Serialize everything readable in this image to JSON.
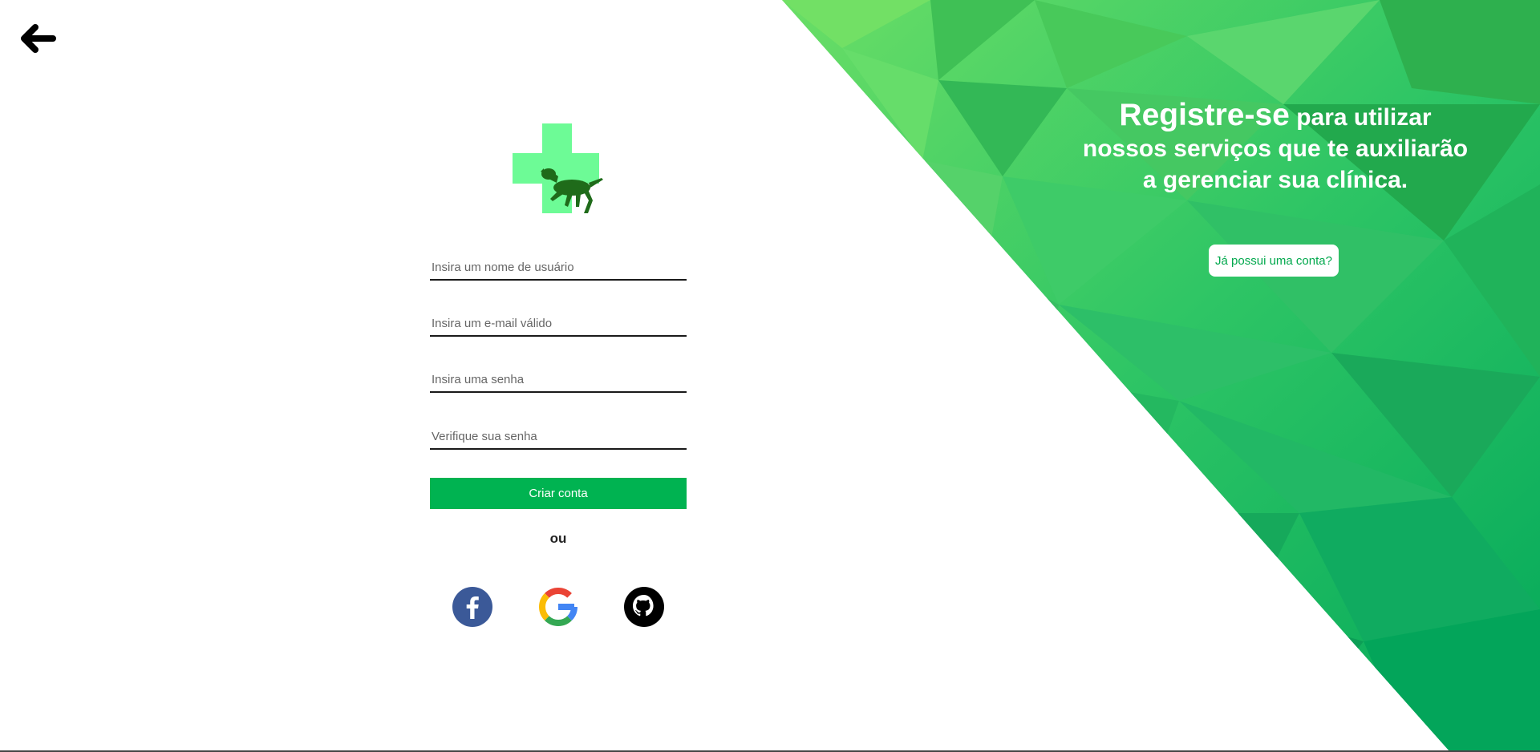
{
  "form": {
    "username_placeholder": "Insira um nome de usuário",
    "email_placeholder": "Insira um e-mail válido",
    "password_placeholder": "Insira uma senha",
    "confirm_placeholder": "Verifique sua senha",
    "submit_label": "Criar conta",
    "or_label": "ou"
  },
  "promo": {
    "highlight": "Registre-se",
    "rest": " para utilizar nossos serviços que te auxiliarão a gerenciar sua clínica.",
    "login_link": "Já possui uma conta?"
  },
  "colors": {
    "accent": "#00b351",
    "logo_cross": "#6dfb96",
    "logo_dog": "#1f6b1a",
    "facebook": "#3b5998",
    "github": "#000000"
  },
  "icons": [
    "arrow-left-icon",
    "vet-logo-icon",
    "facebook-icon",
    "google-icon",
    "github-icon"
  ]
}
